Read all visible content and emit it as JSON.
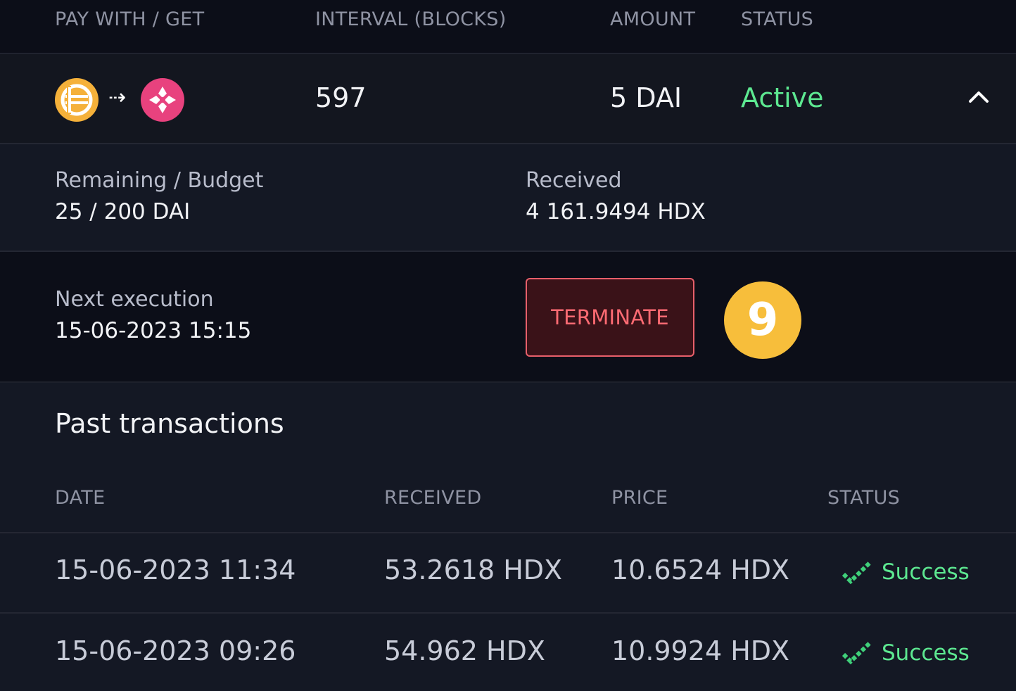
{
  "header": {
    "pay_with_get": "PAY WITH / GET",
    "interval": "INTERVAL (BLOCKS)",
    "amount": "AMOUNT",
    "status": "STATUS"
  },
  "order": {
    "pay_asset_icon": "dai-token-icon",
    "get_asset_icon": "hdx-token-icon",
    "interval": "597",
    "amount": "5 DAI",
    "status": "Active",
    "expand_icon": "chevron-up-icon"
  },
  "details": {
    "remaining_label": "Remaining / Budget",
    "remaining_value": "25 / 200 DAI",
    "received_label": "Received",
    "received_value": "4 161.9494 HDX"
  },
  "execution": {
    "label": "Next execution",
    "value": "15-06-2023 15:15",
    "terminate_label": "TERMINATE",
    "step_badge": "9"
  },
  "past": {
    "title": "Past transactions",
    "headers": {
      "date": "DATE",
      "received": "RECEIVED",
      "price": "PRICE",
      "status": "STATUS"
    },
    "rows": [
      {
        "date": "15-06-2023 11:34",
        "received": "53.2618 HDX",
        "price": "10.6524 HDX",
        "status": "Success"
      },
      {
        "date": "15-06-2023 09:26",
        "received": "54.962 HDX",
        "price": "10.9924 HDX",
        "status": "Success"
      }
    ]
  },
  "colors": {
    "active_green": "#5de891",
    "terminate_red": "#ff6b73",
    "badge_yellow": "#f7be3b",
    "dai": "#f5b13a",
    "hdx": "#e8427e"
  }
}
